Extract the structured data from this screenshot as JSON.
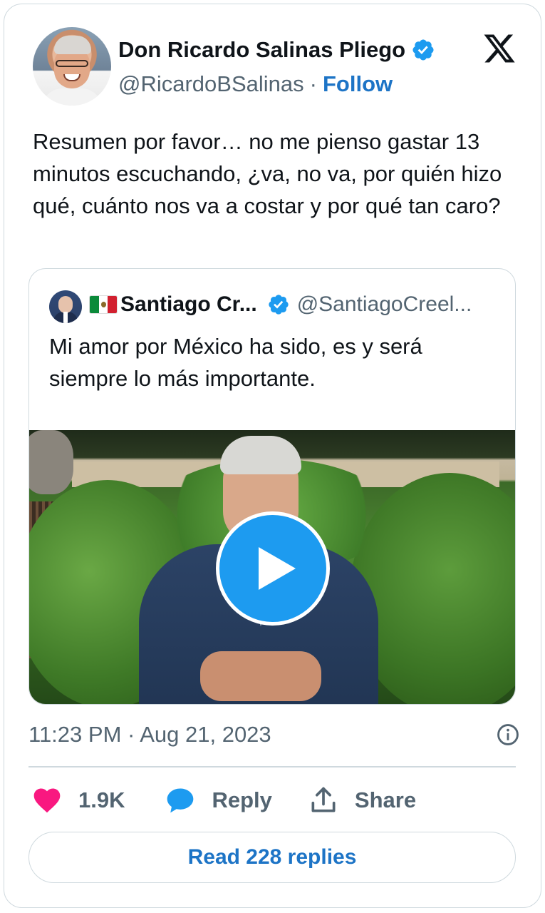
{
  "author": {
    "display_name": "Don Ricardo Salinas Pliego",
    "handle": "@RicardoBSalinas",
    "separator": "·",
    "follow_label": "Follow",
    "verified": true
  },
  "tweet": {
    "text": "Resumen por favor… no me pienso gastar 13 minutos escuchando, ¿va, no va, por quién hizo qué, cuánto nos va a costar y por qué tan caro?"
  },
  "quoted_tweet": {
    "display_name": "Santiago Cr...",
    "handle": "@SantiagoCreel...",
    "flag": "mexico-flag",
    "verified": true,
    "text": "Mi amor por México ha sido, es y será siempre lo más importante.",
    "media": {
      "type": "video",
      "icon": "play-icon"
    }
  },
  "meta": {
    "timestamp": "11:23 PM · Aug 21, 2023"
  },
  "actions": {
    "likes_count": "1.9K",
    "reply_label": "Reply",
    "share_label": "Share"
  },
  "read_replies_label": "Read 228 replies",
  "colors": {
    "accent": "#1d9bf0",
    "link": "#1d74c6",
    "like": "#f91880",
    "text_secondary": "#536471",
    "border": "#cfd9de"
  }
}
